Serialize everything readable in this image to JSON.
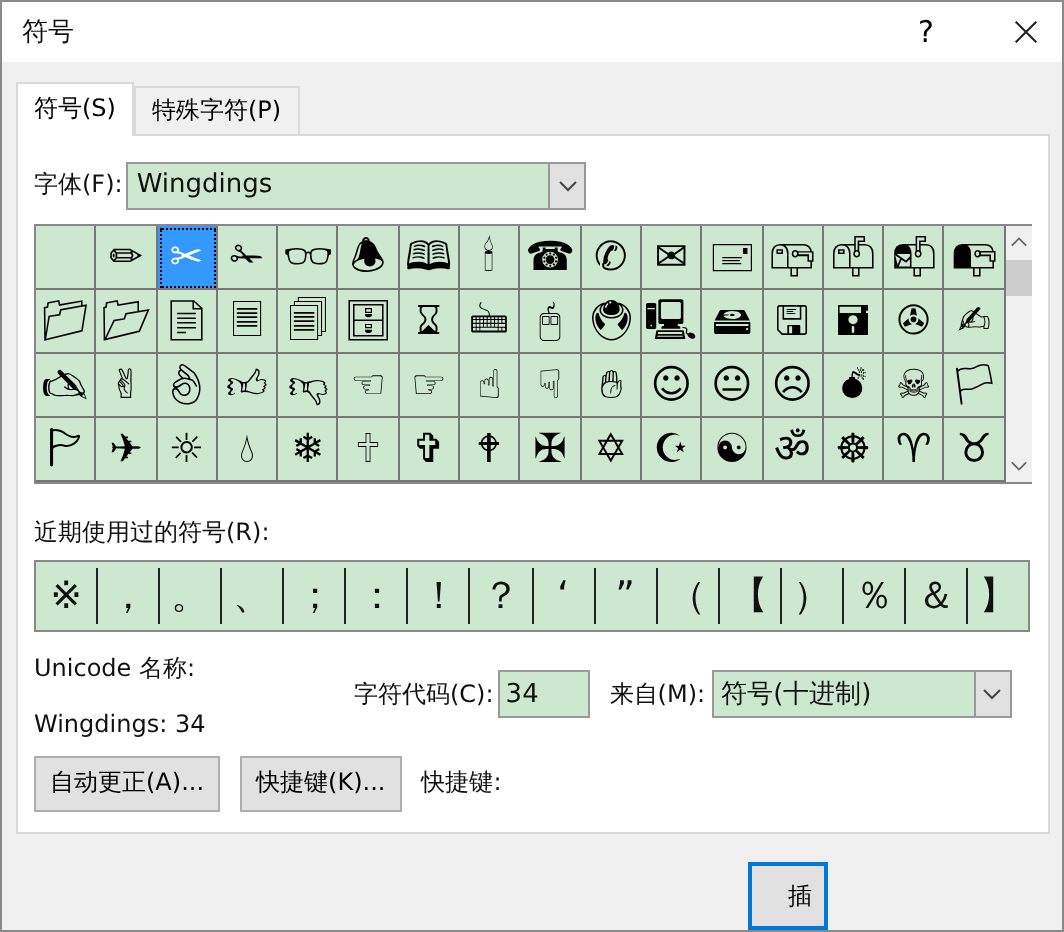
{
  "window": {
    "title": "符号",
    "help": "?"
  },
  "tabs": [
    {
      "label": "符号(S)",
      "selected": true
    },
    {
      "label": "特殊字符(P)",
      "selected": false
    }
  ],
  "font": {
    "label": "字体(F):",
    "value": "Wingdings"
  },
  "symbols": [
    {
      "selected": false
    },
    {
      "glyph": "✏",
      "selected": false
    },
    {
      "glyph": "✂",
      "selected": true
    },
    {
      "glyph": "✁",
      "selected": false
    },
    {
      "glyph": "👓",
      "selected": false
    },
    {
      "glyph": "🕭",
      "selected": false
    },
    {
      "glyph": "🕮",
      "selected": false
    },
    {
      "glyph": "🕯",
      "selected": false
    },
    {
      "glyph": "☎",
      "selected": false
    },
    {
      "glyph": "✆",
      "selected": false
    },
    {
      "glyph": "✉",
      "selected": false
    },
    {
      "glyph": "🖃",
      "selected": false
    },
    {
      "glyph": "📪",
      "selected": false
    },
    {
      "glyph": "📫",
      "selected": false
    },
    {
      "glyph": "📬",
      "selected": false
    },
    {
      "glyph": "📭",
      "selected": false
    },
    {
      "glyph": "📁",
      "selected": false
    },
    {
      "glyph": "📂",
      "selected": false
    },
    {
      "glyph": "📄",
      "selected": false
    },
    {
      "glyph": "🗏",
      "selected": false
    },
    {
      "glyph": "🗐",
      "selected": false
    },
    {
      "glyph": "🗄",
      "selected": false
    },
    {
      "glyph": "⌛",
      "selected": false
    },
    {
      "glyph": "🖮",
      "selected": false
    },
    {
      "glyph": "🖰",
      "selected": false
    },
    {
      "glyph": "🖲",
      "selected": false
    },
    {
      "glyph": "🖳",
      "selected": false
    },
    {
      "glyph": "🖴",
      "selected": false
    },
    {
      "glyph": "🖫",
      "selected": false
    },
    {
      "glyph": "🖬",
      "selected": false
    },
    {
      "glyph": "✇",
      "selected": false
    },
    {
      "glyph": "✍",
      "selected": false
    },
    {
      "glyph": "🖎",
      "selected": false
    },
    {
      "glyph": "✌",
      "selected": false
    },
    {
      "glyph": "👌",
      "selected": false
    },
    {
      "glyph": "👍",
      "selected": false
    },
    {
      "glyph": "👎",
      "selected": false
    },
    {
      "glyph": "☜",
      "selected": false
    },
    {
      "glyph": "☞",
      "selected": false
    },
    {
      "glyph": "☝",
      "selected": false
    },
    {
      "glyph": "☟",
      "selected": false
    },
    {
      "glyph": "✋",
      "selected": false
    },
    {
      "glyph": "☺",
      "selected": false
    },
    {
      "glyph": "😐",
      "selected": false
    },
    {
      "glyph": "☹",
      "selected": false
    },
    {
      "glyph": "💣",
      "selected": false
    },
    {
      "glyph": "☠",
      "selected": false
    },
    {
      "glyph": "🏳",
      "selected": false
    },
    {
      "glyph": "🏱",
      "selected": false
    },
    {
      "glyph": "✈",
      "selected": false
    },
    {
      "glyph": "☼",
      "selected": false
    },
    {
      "glyph": "💧",
      "selected": false
    },
    {
      "glyph": "❄",
      "selected": false
    },
    {
      "glyph": "🕆",
      "selected": false
    },
    {
      "glyph": "✞",
      "selected": false
    },
    {
      "glyph": "🕈",
      "selected": false
    },
    {
      "glyph": "✠",
      "selected": false
    },
    {
      "glyph": "✡",
      "selected": false
    },
    {
      "glyph": "☪",
      "selected": false
    },
    {
      "glyph": "☯",
      "selected": false
    },
    {
      "glyph": "ॐ",
      "selected": false
    },
    {
      "glyph": "☸",
      "selected": false
    },
    {
      "glyph": "♈",
      "selected": false
    },
    {
      "glyph": "♉",
      "selected": false
    }
  ],
  "recent": {
    "label": "近期使用过的符号(R):",
    "symbols": [
      "※",
      "，",
      "。",
      "、",
      "；",
      "：",
      "！",
      "？",
      "‘",
      "”",
      "（",
      "【",
      "）",
      "％",
      "＆",
      "】"
    ]
  },
  "unicode_name": {
    "label": "Unicode 名称:",
    "value": "Wingdings: 34"
  },
  "char_code": {
    "label": "字符代码(C):",
    "value": "34"
  },
  "from": {
    "label": "来自(M):",
    "value": "符号(十进制)"
  },
  "buttons": [
    {
      "label": "自动更正(A)..."
    },
    {
      "label": "快捷键(K)..."
    }
  ],
  "shortcut": {
    "label": "快捷键:"
  },
  "insert_button": {
    "label": "插"
  }
}
